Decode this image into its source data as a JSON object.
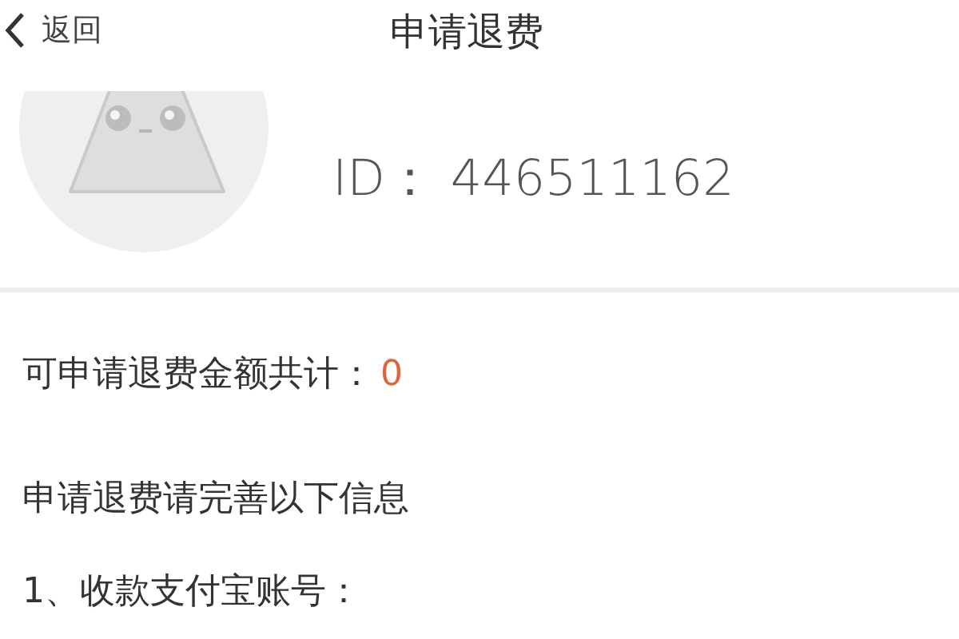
{
  "header": {
    "back_label": "返回",
    "title": "申请退费"
  },
  "profile": {
    "user_id": "ID：  446511162"
  },
  "refund": {
    "label": "可申请退费金额共计：",
    "amount": "0"
  },
  "form": {
    "intro": "申请退费请完善以下信息",
    "fields": [
      {
        "label": "1、收款支付宝账号："
      }
    ]
  }
}
